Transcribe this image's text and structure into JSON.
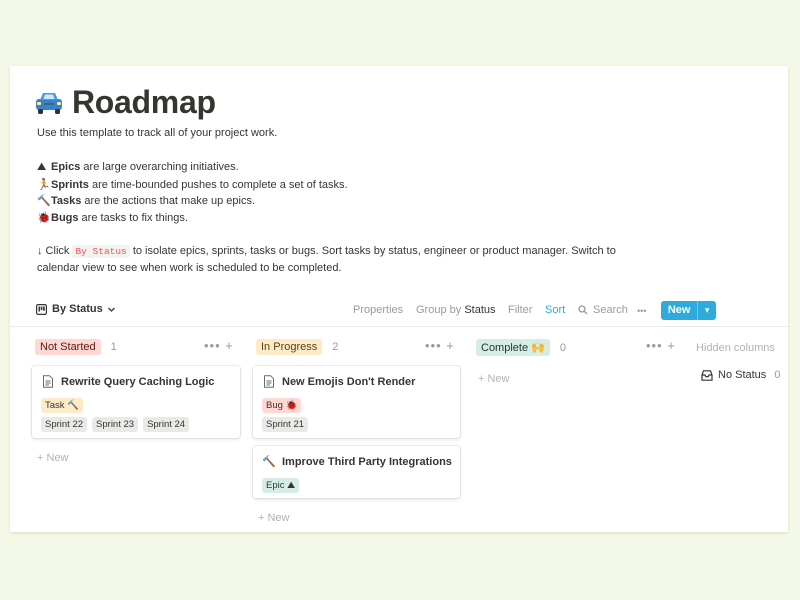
{
  "page": {
    "title": "Roadmap",
    "title_icon": "car-icon",
    "intro": "Use this template to track all of your project work.",
    "legend": [
      {
        "icon": "⛰",
        "bold": "Epics",
        "text": " are large overarching initiatives."
      },
      {
        "icon": "🏃",
        "bold": "Sprints",
        "text": " are time-bounded pushes to complete a set of tasks."
      },
      {
        "icon": "🔨",
        "bold": "Tasks",
        "text": " are the actions that make up epics."
      },
      {
        "icon": "🐞",
        "bold": "Bugs",
        "text": " are tasks to fix things."
      }
    ],
    "hint_arrow": "↓",
    "hint_click": " Click ",
    "hint_code": "By Status",
    "hint_rest": " to isolate epics, sprints, tasks or bugs. Sort tasks by status, engineer or product manager. Switch to",
    "hint_line2": "calendar view to see when work is scheduled to be completed."
  },
  "toolbar": {
    "view": "By Status",
    "properties": "Properties",
    "group_by": "Group by",
    "group_value": "Status",
    "filter": "Filter",
    "sort": "Sort",
    "search": "Search",
    "more": "•••",
    "new": "New",
    "new_arrow": "▾"
  },
  "columns": [
    {
      "name": "Not Started",
      "count": "1",
      "color": "#ffd8d4",
      "text_color": "#5d1715"
    },
    {
      "name": "In Progress",
      "count": "2",
      "color": "#fbecc7",
      "text_color": "#5f3d14"
    },
    {
      "name": "Complete 🙌",
      "count": "0",
      "color": "#d6ede4",
      "text_color": "#1c3829"
    }
  ],
  "column_actions": "••• +",
  "cards": [
    {
      "title": "Rewrite Query Caching Logic",
      "icon": "page-icon",
      "type": "Task 🔨",
      "sprints": [
        "Sprint 22",
        "Sprint 23",
        "Sprint 24"
      ]
    },
    {
      "title": "New Emojis Don't Render",
      "icon": "page-icon",
      "type": "Bug 🐞",
      "sprints": [
        "Sprint 21"
      ]
    },
    {
      "title": "Improve Third Party Integrations",
      "icon": "🔨",
      "type": "Epic ⛰",
      "sprints": []
    }
  ],
  "new_label": "+ New",
  "hidden": {
    "label": "Hidden columns",
    "item": "No Status",
    "count": "0"
  }
}
